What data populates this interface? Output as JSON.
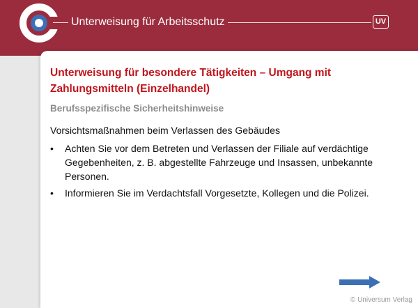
{
  "header": {
    "title": "Unterweisung für Arbeitsschutz",
    "badge": "UV"
  },
  "slide": {
    "title": "Unterweisung für besondere Tätigkeiten – Umgang mit Zahlungsmitteln (Einzelhandel)",
    "subtitle": "Berufsspezifische Sicherheitshinweise",
    "section_heading": "Vorsichtsmaßnahmen beim Verlassen des Gebäudes",
    "bullets": [
      "Achten Sie vor dem Betreten und Verlassen der Filiale auf verdächtige Gegebenheiten, z. B. abgestellte Fahrzeuge und Insassen, unbekannte Personen.",
      "Informieren Sie im Verdachtsfall Vorgesetzte, Kollegen und die Polizei."
    ],
    "copyright": "© Universum Verlag"
  },
  "icons": {
    "logo": "universum-logo",
    "badge": "uv-badge-icon",
    "next": "arrow-right-icon"
  },
  "colors": {
    "header_bg": "#9b2c3d",
    "title_red": "#c0141c",
    "subtitle_gray": "#8c8c8c",
    "arrow_blue": "#3d6fb5"
  }
}
